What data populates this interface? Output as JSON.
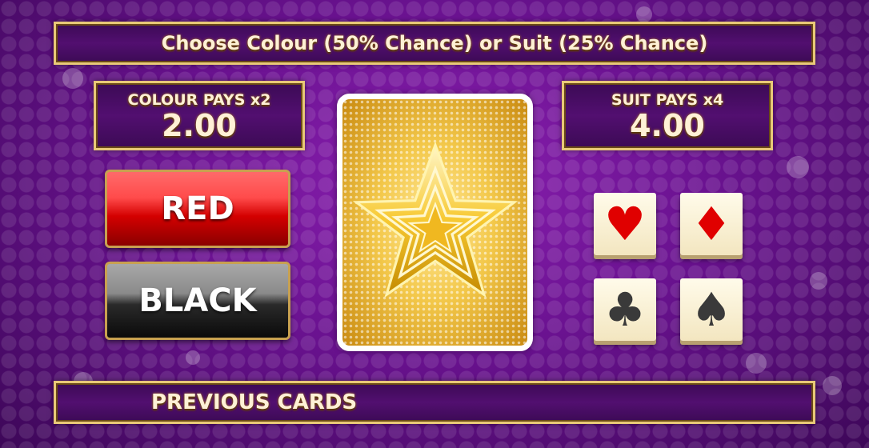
{
  "header": {
    "title": "Choose Colour (50% Chance) or Suit (25% Chance)"
  },
  "colour_pays": {
    "label": "COLOUR PAYS x2",
    "value": "2.00"
  },
  "suit_pays": {
    "label": "SUIT PAYS x4",
    "value": "4.00"
  },
  "colour_buttons": {
    "red_label": "RED",
    "black_label": "BLACK"
  },
  "card": {
    "icon": "star-icon",
    "state": "face-down"
  },
  "suits": [
    {
      "icon": "hearts-icon",
      "color": "#e00000"
    },
    {
      "icon": "diamonds-icon",
      "color": "#e00000"
    },
    {
      "icon": "clubs-icon",
      "color": "#3a3a3a"
    },
    {
      "icon": "spades-icon",
      "color": "#3a3a3a"
    }
  ],
  "previous_cards": {
    "label": "PREVIOUS CARDS"
  },
  "colors": {
    "accent_gold": "#e9c978",
    "background_purple": "#6a1290"
  }
}
